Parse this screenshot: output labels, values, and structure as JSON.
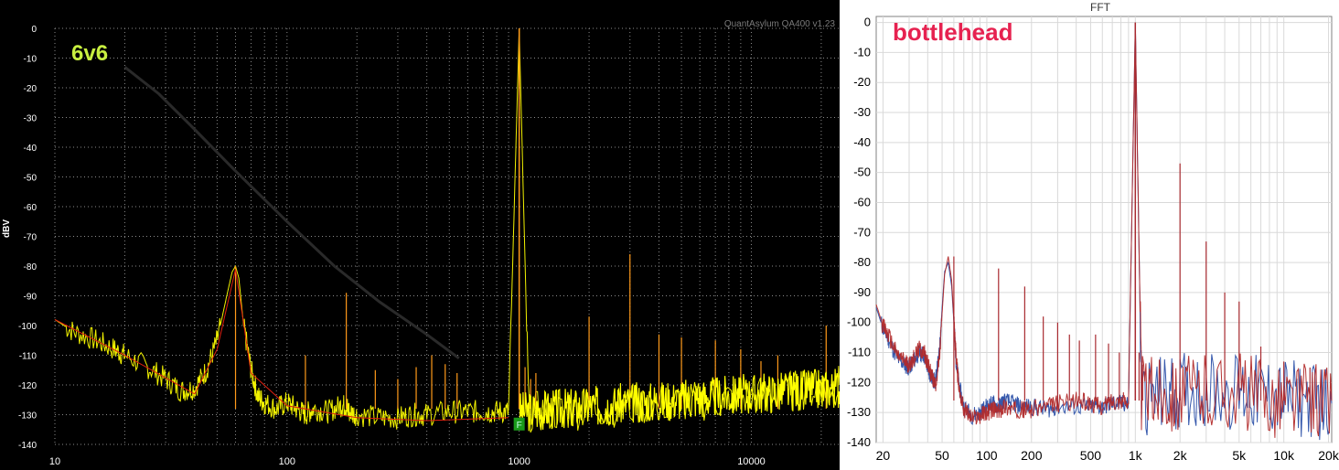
{
  "chart_data": [
    {
      "type": "line",
      "title": "6v6",
      "watermark": "QuantAsylum QA400 v1.23",
      "xlabel": "",
      "ylabel": "dBV",
      "xscale": "log",
      "xlim": [
        10,
        24000
      ],
      "ylim": [
        -140,
        0
      ],
      "x_ticks": [
        10,
        100,
        1000,
        10000
      ],
      "x_tick_labels": [
        "10",
        "100",
        "1000",
        "10000"
      ],
      "y_ticks": [
        0,
        -10,
        -20,
        -30,
        -40,
        -50,
        -60,
        -70,
        -80,
        -90,
        -100,
        -110,
        -120,
        -130,
        -140
      ],
      "y_tick_labels": [
        "0",
        "-10",
        "-20",
        "-30",
        "-40",
        "-50",
        "-60",
        "-70",
        "-80",
        "-90",
        "-100",
        "-110",
        "-120",
        "-130",
        "-140"
      ],
      "grid": true,
      "marker_label": "F",
      "marker_x": 1000,
      "colors": {
        "background": "#000000",
        "series_a": "#ffff00",
        "series_b": "#ff8c1a",
        "series_c": "#e02010",
        "title": "#c8f040",
        "grid": "#8a8a8a",
        "ticks": "#ffffff",
        "marker": "#1a9a1a",
        "ghost": "#2a2a2a"
      },
      "ghost_line": {
        "x": [
          20,
          28,
          40,
          60,
          100,
          160,
          250,
          400,
          550
        ],
        "y": [
          -13,
          -22,
          -34,
          -48,
          -65,
          -80,
          -92,
          -103,
          -111
        ]
      },
      "series": [
        {
          "x": [
            10,
            12,
            15,
            18,
            20,
            25,
            30,
            35,
            40,
            45,
            50,
            55,
            58,
            60,
            62,
            65,
            70,
            75,
            80,
            90,
            100,
            110,
            120,
            130,
            150,
            170,
            180,
            185,
            200,
            250,
            300,
            350,
            400,
            500,
            600,
            700,
            800,
            900,
            1000,
            1100,
            1500,
            2000,
            3000,
            5000,
            7000,
            10000,
            15000,
            20000,
            24000
          ],
          "y": [
            -98,
            -102,
            -105,
            -108,
            -110,
            -114,
            -118,
            -122,
            -121,
            -115,
            -105,
            -90,
            -82,
            -80,
            -84,
            -100,
            -115,
            -124,
            -126,
            -128,
            -126,
            -128,
            -130,
            -128,
            -129,
            -127,
            -127,
            -129,
            -130,
            -131,
            -131,
            -130,
            -130,
            -129,
            -129,
            -129,
            -129,
            -129,
            0,
            -129,
            -129,
            -128,
            -127,
            -126,
            -125,
            -124,
            -122,
            -121,
            -120
          ]
        }
      ],
      "spikes": [
        {
          "x": 60,
          "y": -80
        },
        {
          "x": 120,
          "y": -110
        },
        {
          "x": 180,
          "y": -89
        },
        {
          "x": 240,
          "y": -115
        },
        {
          "x": 300,
          "y": -118
        },
        {
          "x": 360,
          "y": -114
        },
        {
          "x": 420,
          "y": -110
        },
        {
          "x": 480,
          "y": -113
        },
        {
          "x": 540,
          "y": -116
        },
        {
          "x": 1000,
          "y": 0
        },
        {
          "x": 1060,
          "y": -114
        },
        {
          "x": 1120,
          "y": -118
        },
        {
          "x": 1180,
          "y": -116
        },
        {
          "x": 2000,
          "y": -97
        },
        {
          "x": 3000,
          "y": -76
        },
        {
          "x": 4000,
          "y": -103
        },
        {
          "x": 5000,
          "y": -104
        },
        {
          "x": 7000,
          "y": -105
        },
        {
          "x": 9000,
          "y": -108
        },
        {
          "x": 11000,
          "y": -112
        },
        {
          "x": 13000,
          "y": -110
        },
        {
          "x": 21000,
          "y": -100
        }
      ]
    },
    {
      "type": "line",
      "title": "bottlehead",
      "header": "FFT",
      "xlabel": "",
      "ylabel": "",
      "xscale": "log",
      "xlim": [
        18,
        21000
      ],
      "ylim": [
        -140,
        2
      ],
      "x_ticks": [
        20,
        50,
        100,
        200,
        500,
        1000,
        2000,
        5000,
        10000,
        20000
      ],
      "x_tick_labels": [
        "20",
        "50",
        "100",
        "200",
        "500",
        "1k",
        "2k",
        "5k",
        "10k",
        "20k"
      ],
      "y_ticks": [
        0,
        -10,
        -20,
        -30,
        -40,
        -50,
        -60,
        -70,
        -80,
        -90,
        -100,
        -110,
        -120,
        -130,
        -140
      ],
      "y_tick_labels": [
        "0",
        "-10",
        "-20",
        "-30",
        "-40",
        "-50",
        "-60",
        "-70",
        "-80",
        "-90",
        "-100",
        "-110",
        "-120",
        "-130",
        "-140"
      ],
      "grid": true,
      "colors": {
        "background": "#ffffff",
        "series_a": "#2a4fa8",
        "series_b": "#b22a2a",
        "title": "#e62250",
        "grid": "#d9d9d9",
        "ticks": "#000000",
        "frame": "#808080"
      },
      "series": [
        {
          "x": [
            18,
            20,
            22,
            25,
            28,
            30,
            32,
            35,
            38,
            40,
            42,
            45,
            48,
            50,
            52,
            55,
            58,
            60,
            62,
            65,
            70,
            80,
            90,
            100,
            110,
            120,
            130,
            150,
            170,
            200,
            250,
            300,
            400,
            500,
            600,
            700,
            800,
            900,
            1000,
            1100,
            1500,
            2000,
            3000,
            5000,
            7000,
            10000,
            15000,
            21000
          ],
          "y": [
            -95,
            -102,
            -106,
            -112,
            -114,
            -115,
            -113,
            -110,
            -111,
            -115,
            -118,
            -120,
            -110,
            -95,
            -83,
            -80,
            -88,
            -100,
            -112,
            -121,
            -128,
            -131,
            -130,
            -128,
            -127,
            -128,
            -126,
            -127,
            -128,
            -128,
            -129,
            -128,
            -128,
            -128,
            -128,
            -127,
            -127,
            -127,
            0,
            -125,
            -124,
            -123,
            -122,
            -123,
            -124,
            -125,
            -126,
            -127
          ]
        },
        {
          "x": [
            18,
            20,
            22,
            25,
            28,
            30,
            32,
            35,
            38,
            40,
            42,
            45,
            48,
            50,
            52,
            55,
            58,
            60,
            62,
            65,
            70,
            80,
            90,
            100,
            110,
            120,
            130,
            150,
            170,
            200,
            250,
            300,
            400,
            500,
            600,
            700,
            800,
            900,
            1000,
            1100,
            1500,
            2000,
            3000,
            5000,
            7000,
            10000,
            15000,
            21000
          ],
          "y": [
            -94,
            -101,
            -105,
            -111,
            -113,
            -114,
            -112,
            -109,
            -110,
            -114,
            -117,
            -121,
            -112,
            -97,
            -84,
            -78,
            -86,
            -99,
            -111,
            -122,
            -129,
            -132,
            -131,
            -130,
            -129,
            -130,
            -128,
            -129,
            -129,
            -129,
            -128,
            -127,
            -126,
            -127,
            -128,
            -126,
            -126,
            -126,
            0,
            -124,
            -123,
            -124,
            -123,
            -122,
            -125,
            -126,
            -125,
            -126
          ]
        }
      ],
      "spikes": [
        {
          "x": 60,
          "y": -78
        },
        {
          "x": 120,
          "y": -82
        },
        {
          "x": 180,
          "y": -88
        },
        {
          "x": 240,
          "y": -98
        },
        {
          "x": 300,
          "y": -100
        },
        {
          "x": 360,
          "y": -104
        },
        {
          "x": 420,
          "y": -106
        },
        {
          "x": 540,
          "y": -104
        },
        {
          "x": 660,
          "y": -107
        },
        {
          "x": 780,
          "y": -110
        },
        {
          "x": 1000,
          "y": 0
        },
        {
          "x": 1060,
          "y": -110
        },
        {
          "x": 1120,
          "y": -114
        },
        {
          "x": 2000,
          "y": -47
        },
        {
          "x": 3000,
          "y": -73
        },
        {
          "x": 4000,
          "y": -90
        },
        {
          "x": 5000,
          "y": -93
        },
        {
          "x": 7000,
          "y": -108
        },
        {
          "x": 10000,
          "y": -113
        },
        {
          "x": 15000,
          "y": -115
        }
      ]
    }
  ]
}
